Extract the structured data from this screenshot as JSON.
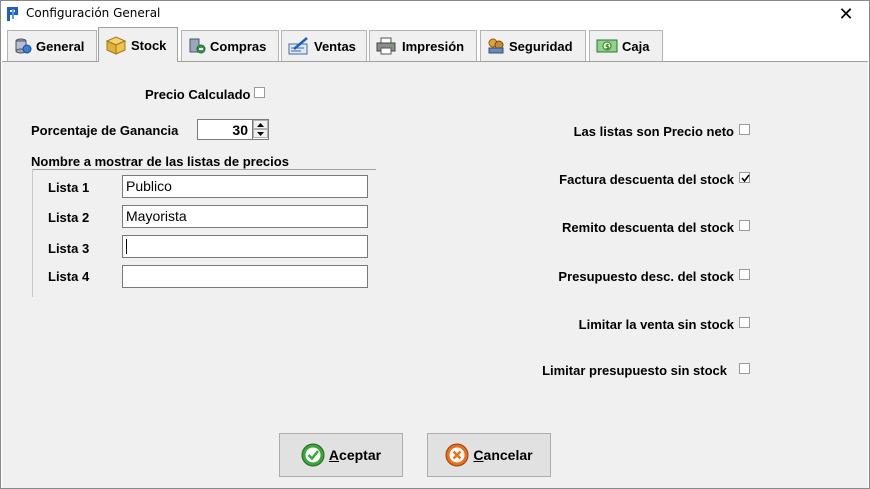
{
  "window": {
    "title": "Configuración General",
    "close_label": "✕"
  },
  "tabs": [
    {
      "label": "General",
      "icon": "database-icon",
      "active": false
    },
    {
      "label": "Stock",
      "icon": "box-icon",
      "active": true
    },
    {
      "label": "Compras",
      "icon": "purchase-icon",
      "active": false
    },
    {
      "label": "Ventas",
      "icon": "sales-icon",
      "active": false
    },
    {
      "label": "Impresión",
      "icon": "printer-icon",
      "active": false
    },
    {
      "label": "Seguridad",
      "icon": "security-icon",
      "active": false
    },
    {
      "label": "Caja",
      "icon": "cash-icon",
      "active": false
    }
  ],
  "stock": {
    "precio_calculado_label": "Precio Calculado",
    "precio_calculado_checked": false,
    "porcentaje_label": "Porcentaje de Ganancia",
    "porcentaje_value": "30",
    "listas_group_label": "Nombre a mostrar de las listas de precios",
    "listas": [
      {
        "label": "Lista 1",
        "value": "Publico"
      },
      {
        "label": "Lista 2",
        "value": "Mayorista"
      },
      {
        "label": "Lista 3",
        "value": ""
      },
      {
        "label": "Lista 4",
        "value": ""
      }
    ],
    "options": [
      {
        "label": "Las listas son Precio neto",
        "checked": false
      },
      {
        "label": "Factura descuenta del stock",
        "checked": true
      },
      {
        "label": "Remito descuenta del stock",
        "checked": false
      },
      {
        "label": "Presupuesto desc. del stock",
        "checked": false
      },
      {
        "label": "Limitar la venta sin stock",
        "checked": false
      },
      {
        "label": "Limitar presupuesto sin stock",
        "checked": false
      }
    ]
  },
  "buttons": {
    "accept_accel": "A",
    "accept_rest": "ceptar",
    "cancel_accel": "C",
    "cancel_rest": "ancelar"
  },
  "colors": {
    "panel_bg": "#f0f0f0",
    "accept_icon": "#3aa53a",
    "cancel_icon": "#e8701e"
  }
}
